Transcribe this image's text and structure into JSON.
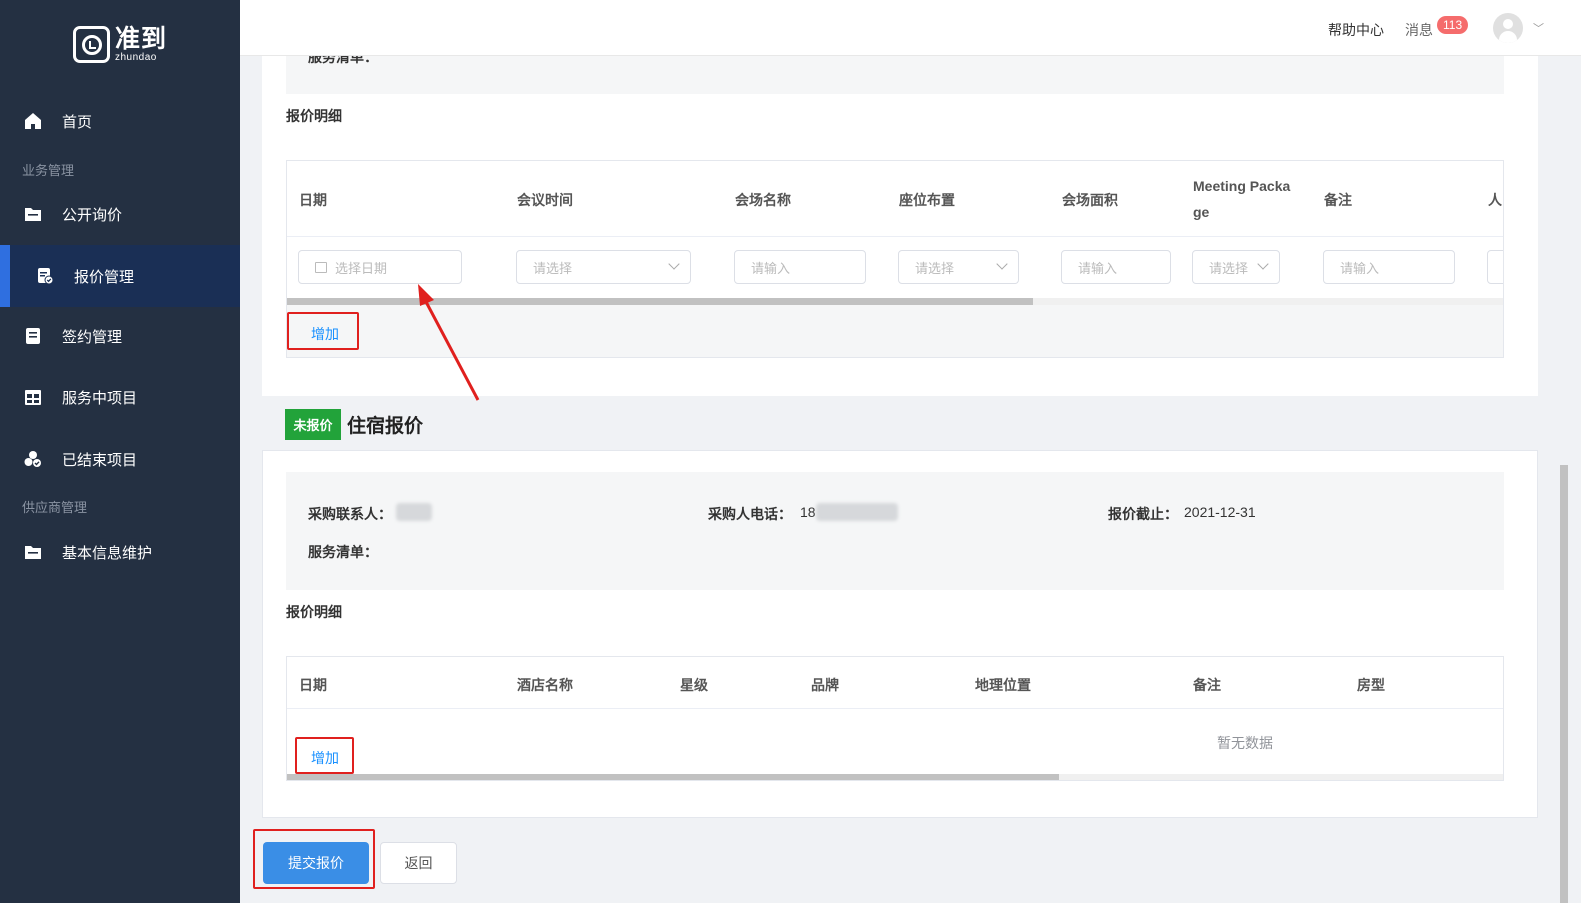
{
  "brand": {
    "name_cn": "准到",
    "name_en": "zhundao"
  },
  "sidebar": {
    "items": [
      {
        "label": "首页"
      },
      {
        "label": "公开询价"
      },
      {
        "label": "报价管理"
      },
      {
        "label": "签约管理"
      },
      {
        "label": "服务中项目"
      },
      {
        "label": "已结束项目"
      },
      {
        "label": "基本信息维护"
      }
    ],
    "sections": [
      "业务管理",
      "供应商管理"
    ]
  },
  "topbar": {
    "help": "帮助中心",
    "messages": "消息",
    "message_count": "113"
  },
  "meeting": {
    "cut_label": "服务清单：",
    "detail_label": "报价明细",
    "columns": [
      "日期",
      "会议时间",
      "会场名称",
      "座位布置",
      "会场面积",
      "Meeting Packa",
      "ge",
      "备注",
      "人"
    ],
    "inputs": {
      "date": "选择日期",
      "time": "请选择",
      "venue": "请输入",
      "seating": "请选择",
      "area": "请输入",
      "package": "请选择",
      "remark": "请输入"
    },
    "add_label": "增加"
  },
  "lodging": {
    "status": "未报价",
    "title": "住宿报价",
    "buyer_label": "采购联系人：",
    "phone_label": "采购人电话：",
    "phone_prefix": "18",
    "deadline_label": "报价截止：",
    "deadline_value": "2021-12-31",
    "services_label": "服务清单：",
    "detail_label": "报价明细",
    "columns": [
      "日期",
      "酒店名称",
      "星级",
      "品牌",
      "地理位置",
      "备注",
      "房型"
    ],
    "empty": "暂无数据",
    "add_label": "增加"
  },
  "actions": {
    "submit": "提交报价",
    "back": "返回"
  },
  "colors": {
    "sidebar": "#243042",
    "active": "#1a2f55",
    "accent": "#2f6fe0",
    "status_green": "#22a33a",
    "annotation_red": "#e0201e"
  }
}
